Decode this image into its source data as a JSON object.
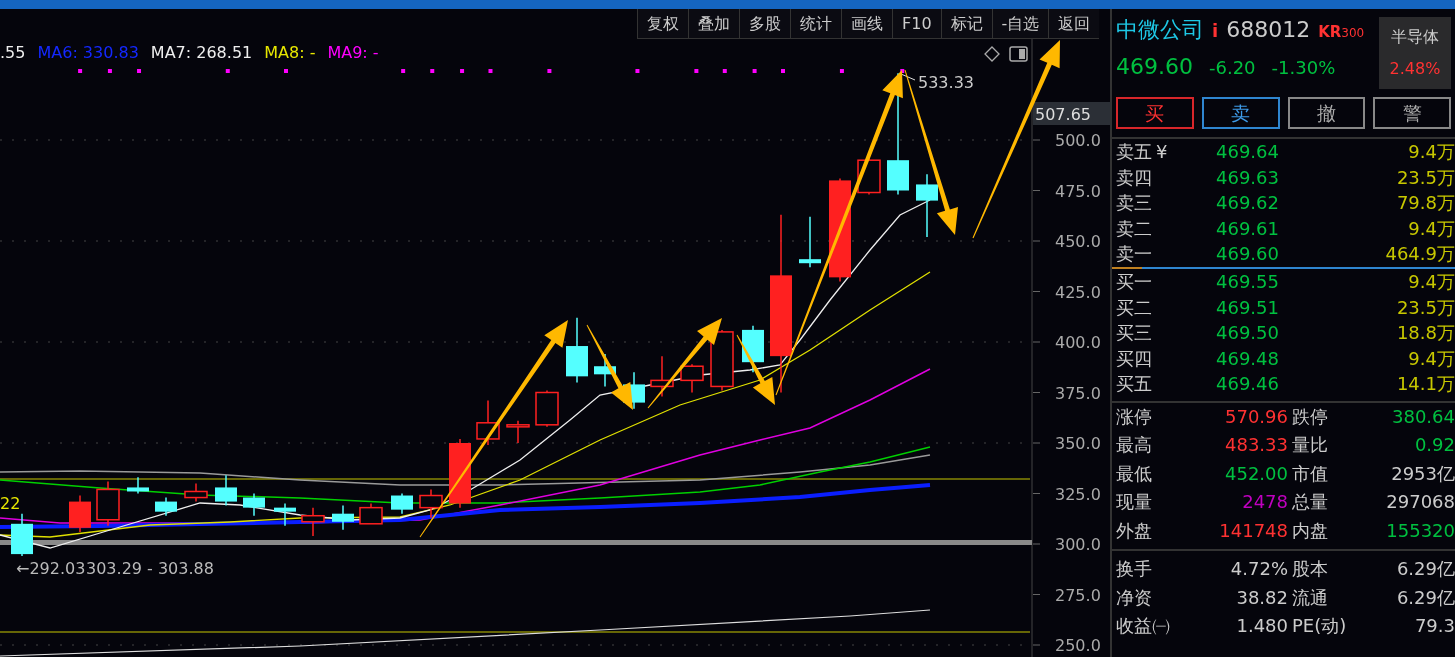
{
  "toolbar": {
    "buttons": [
      "复权",
      "叠加",
      "多股",
      "统计",
      "画线",
      "F10",
      "标记",
      "-自选",
      "返回"
    ]
  },
  "chart": {
    "legend": [
      {
        "text": ".55",
        "color": "#eeeeee"
      },
      {
        "text": "MA6: 330.83",
        "color": "#1428ff"
      },
      {
        "text": "MA7: 268.51",
        "color": "#eeeeee"
      },
      {
        "text": "MA8: -",
        "color": "#e8e800"
      },
      {
        "text": "MA9: -",
        "color": "#ff00ff"
      }
    ],
    "high_label": "533.33",
    "left_label": "22",
    "range_labels": [
      "←292.03",
      "303.29 - 303.88"
    ],
    "price_tag": "507.65",
    "y_axis": [
      "500.0",
      "475.0",
      "450.0",
      "425.0",
      "400.0",
      "375.0",
      "350.0",
      "325.0",
      "300.0",
      "275.0",
      "250.0"
    ]
  },
  "quote": {
    "name": "中微公司",
    "info_mark": "i",
    "code": "688012",
    "badge": "KR",
    "badge_suffix": "300",
    "sector": {
      "name": "半导体",
      "change": "2.48%"
    },
    "price": "469.60",
    "change": "-6.20",
    "change_pct": "-1.30%"
  },
  "actions": [
    {
      "label": "买",
      "kind": "buy"
    },
    {
      "label": "卖",
      "kind": "sell"
    },
    {
      "label": "撤",
      "kind": "plain"
    },
    {
      "label": "警",
      "kind": "plain"
    }
  ],
  "order_book": {
    "asks": [
      {
        "label": "卖五",
        "currency_mark": "¥",
        "price": "469.64",
        "volume": "9.4万"
      },
      {
        "label": "卖四",
        "price": "469.63",
        "volume": "23.5万"
      },
      {
        "label": "卖三",
        "price": "469.62",
        "volume": "79.8万"
      },
      {
        "label": "卖二",
        "price": "469.61",
        "volume": "9.4万"
      },
      {
        "label": "卖一",
        "price": "469.60",
        "volume": "464.9万"
      }
    ],
    "bids": [
      {
        "label": "买一",
        "price": "469.55",
        "volume": "9.4万"
      },
      {
        "label": "买二",
        "price": "469.51",
        "volume": "23.5万"
      },
      {
        "label": "买三",
        "price": "469.50",
        "volume": "18.8万"
      },
      {
        "label": "买四",
        "price": "469.48",
        "volume": "9.4万"
      },
      {
        "label": "买五",
        "price": "469.46",
        "volume": "14.1万"
      }
    ]
  },
  "stats": [
    [
      {
        "label": "涨停",
        "value": "570.96",
        "color": "#ff3232"
      },
      {
        "label": "跌停",
        "value": "380.64",
        "color": "#00c040"
      }
    ],
    [
      {
        "label": "最高",
        "value": "483.33",
        "color": "#ff3232"
      },
      {
        "label": "量比",
        "value": "0.92",
        "color": "#00c040"
      }
    ],
    [
      {
        "label": "最低",
        "value": "452.00",
        "color": "#00c040"
      },
      {
        "label": "市值",
        "value": "2953亿",
        "color": "#cccccc"
      }
    ],
    [
      {
        "label": "现量",
        "value": "2478",
        "color": "#c000c0"
      },
      {
        "label": "总量",
        "value": "297068",
        "color": "#cccccc"
      }
    ],
    [
      {
        "label": "外盘",
        "value": "141748",
        "color": "#ff3232"
      },
      {
        "label": "内盘",
        "value": "155320",
        "color": "#00c040"
      }
    ]
  ],
  "fundamentals": [
    [
      {
        "label": "换手",
        "value": "4.72%",
        "color": "#cccccc"
      },
      {
        "label": "股本",
        "value": "6.29亿",
        "color": "#cccccc"
      }
    ],
    [
      {
        "label": "净资",
        "value": "38.82",
        "color": "#cccccc"
      },
      {
        "label": "流通",
        "value": "6.29亿",
        "color": "#cccccc"
      }
    ],
    [
      {
        "label": "收益㈠",
        "value": "1.480",
        "color": "#cccccc"
      },
      {
        "label": "PE(动)",
        "value": "79.3",
        "color": "#cccccc"
      }
    ]
  ]
}
